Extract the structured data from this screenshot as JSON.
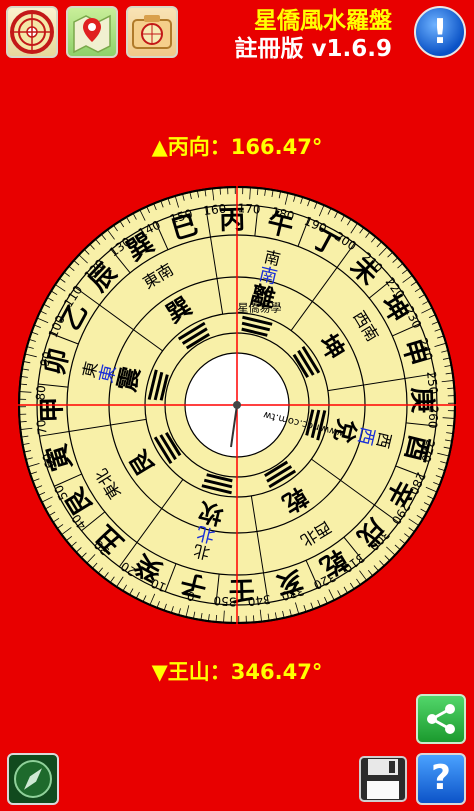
{
  "header": {
    "title": "星僑風水羅盤",
    "version": "註冊版 v1.6.9"
  },
  "toolbar": {
    "compass_icon": "compass-icon",
    "map_icon": "map-pin-icon",
    "camera_icon": "camera-compass-icon",
    "info_label": "!"
  },
  "reading": {
    "facing": "▲丙向：166.47°",
    "sitting": "▼王山：346.47°",
    "needle_degrees": 166.47
  },
  "compass": {
    "colors": {
      "face": "#f8f0a8",
      "rim": "#e80000",
      "ink": "#000000",
      "blue": "#1a2fd8",
      "needle": "#ff0000"
    },
    "degree_labels": [
      "0",
      "10",
      "20",
      "30",
      "40",
      "50",
      "60",
      "70",
      "80",
      "90",
      "100",
      "110",
      "120",
      "130",
      "140",
      "150",
      "160",
      "170",
      "180",
      "190",
      "200",
      "210",
      "220",
      "230",
      "240",
      "250",
      "260",
      "270",
      "280",
      "290",
      "300",
      "310",
      "320",
      "330",
      "340",
      "350"
    ],
    "mountains": [
      "子",
      "癸",
      "丑",
      "艮",
      "寅",
      "甲",
      "卯",
      "乙",
      "辰",
      "巽",
      "巳",
      "丙",
      "午",
      "丁",
      "未",
      "坤",
      "申",
      "庚",
      "酉",
      "辛",
      "戌",
      "乾",
      "亥",
      "壬"
    ],
    "directions": [
      "北",
      "東北",
      "東",
      "東南",
      "南",
      "西南",
      "西",
      "西北"
    ],
    "trigrams": [
      "坎",
      "艮",
      "震",
      "巽",
      "離",
      "坤",
      "兌",
      "乾"
    ],
    "direction_labels_blue": [
      "北",
      "東",
      "南",
      "西"
    ],
    "watermark": [
      "www.ncc.com.tw",
      "星僑易學"
    ]
  },
  "bottom": {
    "share_icon": "share-icon",
    "mini_compass_icon": "mini-compass-icon",
    "save_icon": "floppy-disk-icon",
    "help_label": "?"
  }
}
